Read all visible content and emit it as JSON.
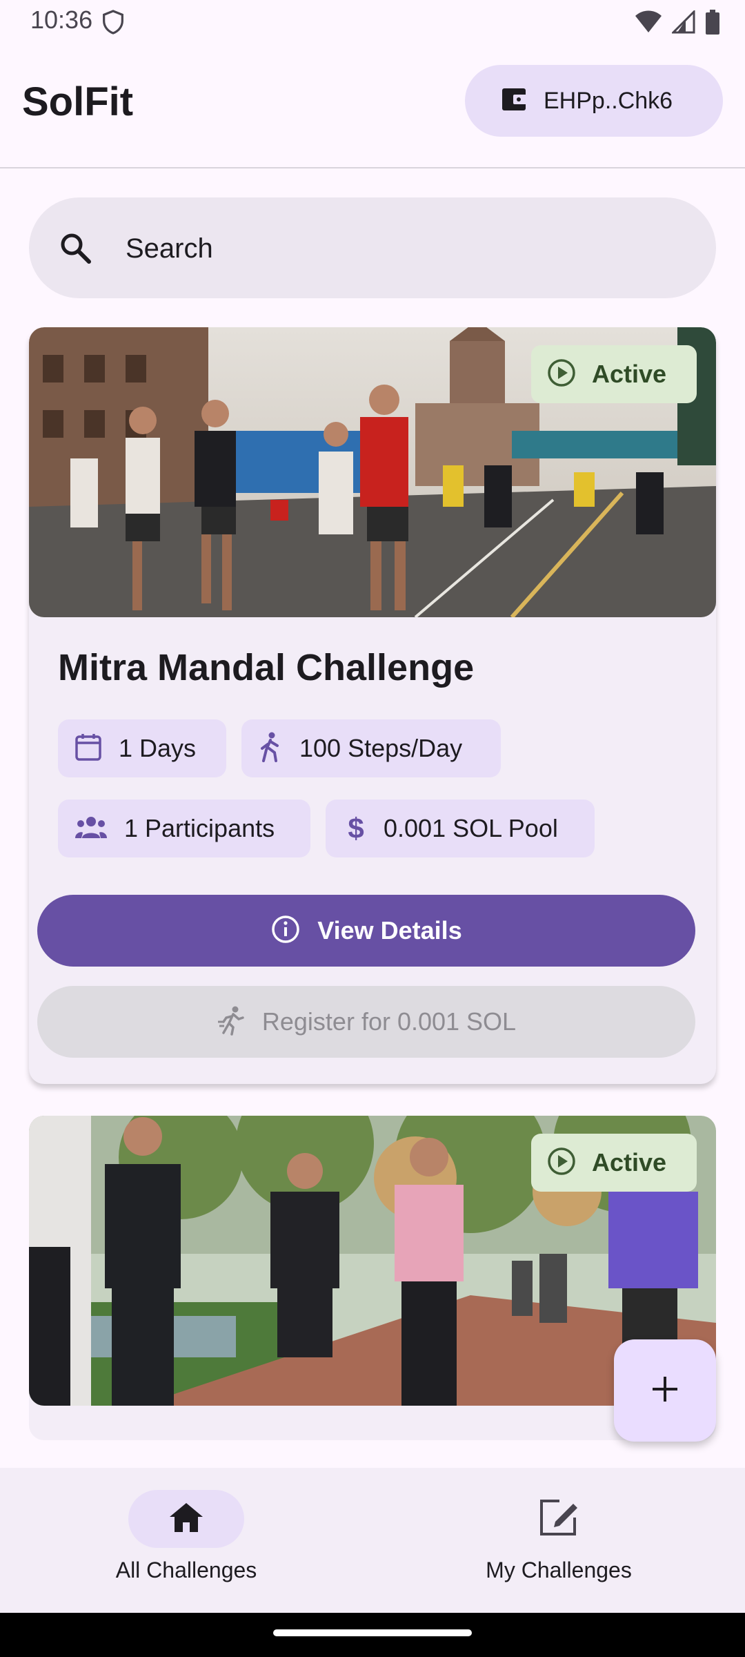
{
  "status_bar": {
    "time": "10:36"
  },
  "app": {
    "title": "SolFit",
    "wallet_address": "EHPp..Chk6"
  },
  "search": {
    "placeholder": "Search"
  },
  "challenges": [
    {
      "status": "Active",
      "title": "Mitra Mandal Challenge",
      "duration": "1 Days",
      "steps": "100 Steps/Day",
      "participants": "1 Participants",
      "pool": "0.001 SOL Pool",
      "view_details_label": "View Details",
      "register_label": "Register for 0.001 SOL"
    },
    {
      "status": "Active"
    }
  ],
  "bottom_nav": {
    "items": [
      {
        "label": "All Challenges",
        "icon": "home-icon",
        "selected": true
      },
      {
        "label": "My Challenges",
        "icon": "edit-square-icon",
        "selected": false
      }
    ]
  },
  "colors": {
    "primary": "#6750A4",
    "chip": "#E8DEF8",
    "active_badge": "#DDEBD3",
    "background": "#FEF7FF"
  }
}
